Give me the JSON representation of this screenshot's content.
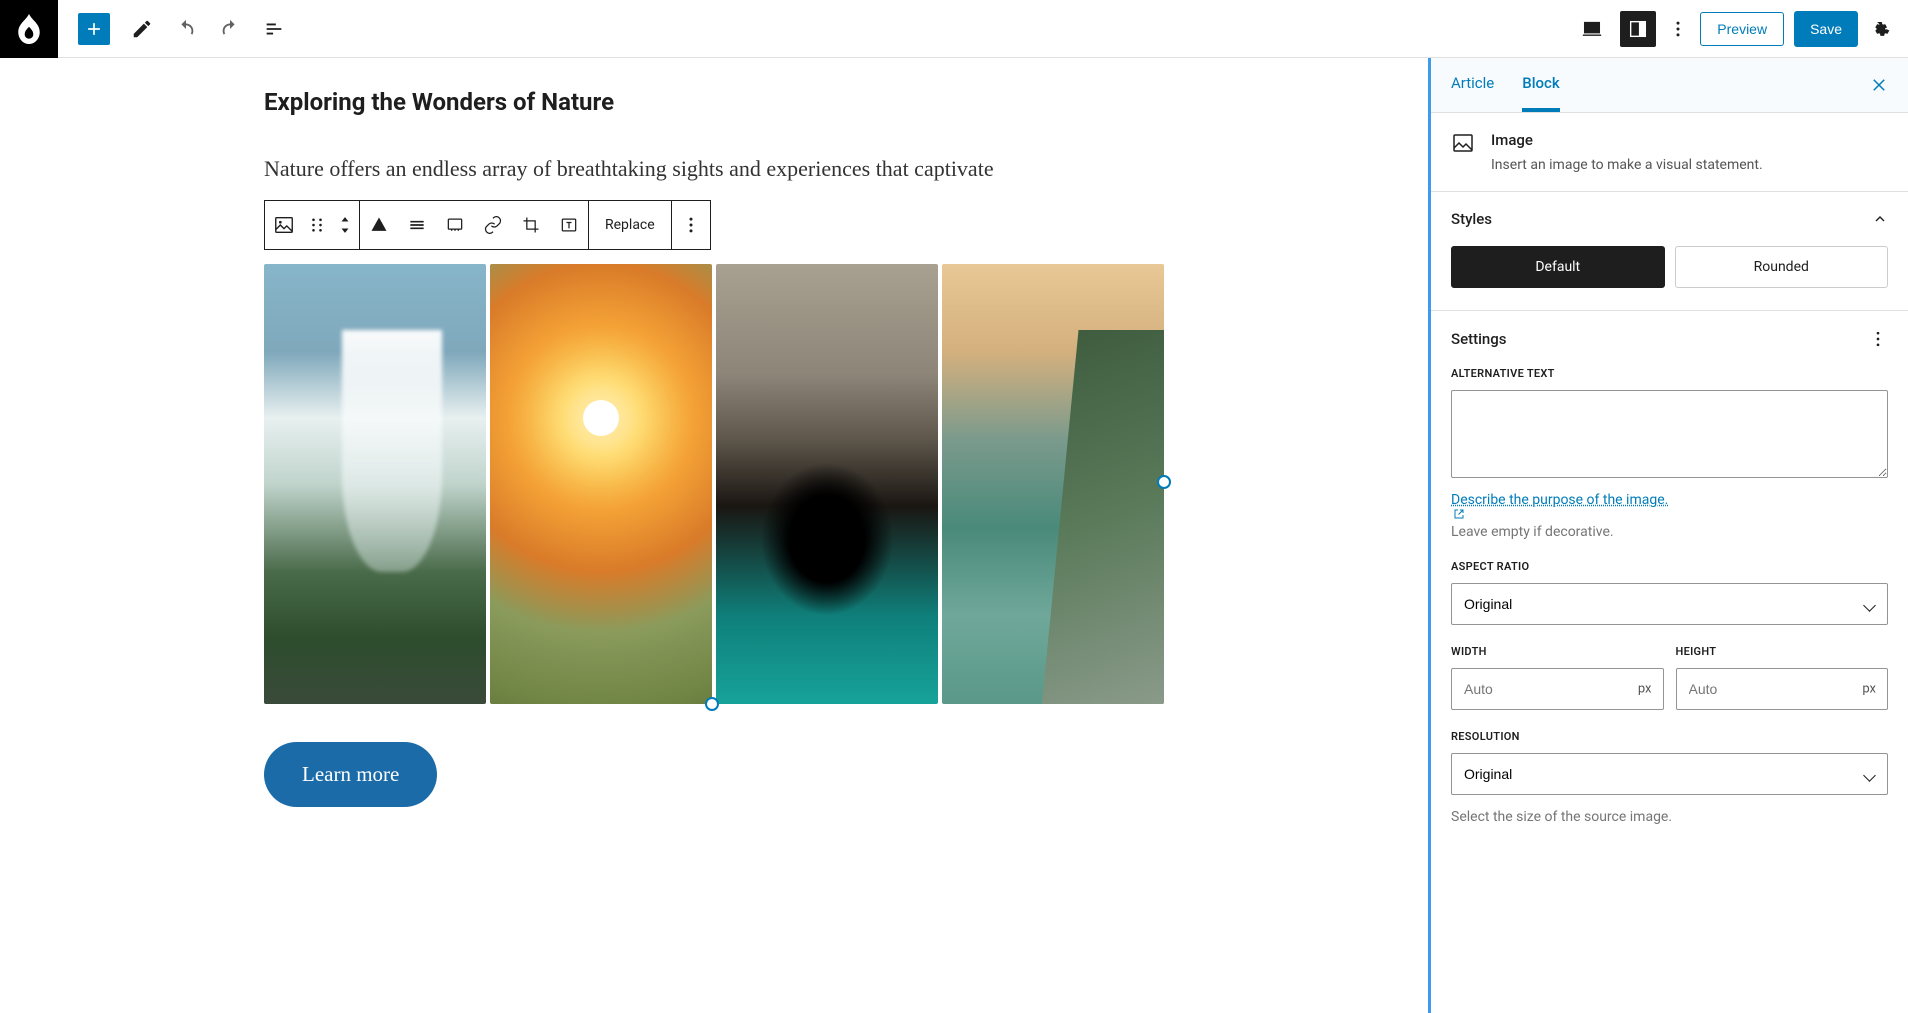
{
  "topbar": {
    "preview_label": "Preview",
    "save_label": "Save"
  },
  "editor": {
    "title": "Exploring the Wonders of Nature",
    "paragraph": "Nature offers an endless array of breathtaking sights and experiences that captivate",
    "replace_label": "Replace",
    "cta_label": "Learn more"
  },
  "sidebar": {
    "tab_article": "Article",
    "tab_block": "Block",
    "block_name": "Image",
    "block_desc": "Insert an image to make a visual statement.",
    "styles_heading": "Styles",
    "style_default": "Default",
    "style_rounded": "Rounded",
    "settings_heading": "Settings",
    "alt_label": "ALTERNATIVE TEXT",
    "alt_help_link": "Describe the purpose of the image.",
    "alt_help_text": "Leave empty if decorative.",
    "aspect_label": "ASPECT RATIO",
    "aspect_value": "Original",
    "width_label": "WIDTH",
    "height_label": "HEIGHT",
    "dim_placeholder": "Auto",
    "dim_unit": "px",
    "resolution_label": "RESOLUTION",
    "resolution_value": "Original",
    "resolution_help": "Select the size of the source image."
  }
}
